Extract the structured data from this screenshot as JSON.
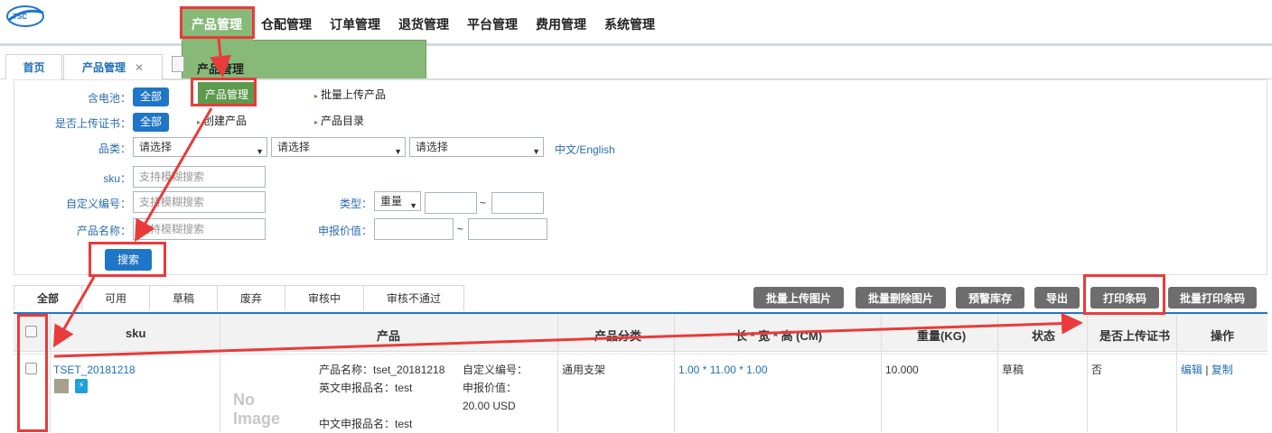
{
  "top_nav": {
    "items": [
      "产品管理",
      "仓配管理",
      "订单管理",
      "退货管理",
      "平台管理",
      "费用管理",
      "系统管理"
    ]
  },
  "menu": {
    "header": "产品管理",
    "items": [
      "产品管理",
      "批量上传产品",
      "创建产品",
      "产品目录"
    ]
  },
  "page_tabs": {
    "home": "首页",
    "product": "产品管理",
    "close": "✕"
  },
  "filter": {
    "battery_label": "含电池：",
    "battery_value": "全部",
    "cert_label": "是否上传证书：",
    "cert_value": "全部",
    "category_label": "品类：",
    "category_options": [
      "请选择",
      "请选择",
      "请选择"
    ],
    "lang_link": "中文/English",
    "sku_label": "sku：",
    "sku_placeholder": "支持模糊搜索",
    "custom_label": "自定义编号：",
    "custom_placeholder": "支持模糊搜索",
    "name_label": "产品名称：",
    "name_placeholder": "支持模糊搜索",
    "type_label": "类型：",
    "type_value": "重量",
    "tilde": "~",
    "declared_label": "申报价值：",
    "search_button": "搜索"
  },
  "status_tabs": [
    "全部",
    "可用",
    "草稿",
    "废弃",
    "审核中",
    "审核不通过"
  ],
  "actions": [
    "批量上传图片",
    "批量删除图片",
    "预警库存",
    "导出",
    "打印条码",
    "批量打印条码"
  ],
  "table": {
    "headers": [
      "sku",
      "产品",
      "产品分类",
      "长 * 宽 * 高 (CM)",
      "重量(KG)",
      "状态",
      "是否上传证书",
      "操作"
    ],
    "row": {
      "sku": "TSET_20181218",
      "no_image": "No Image",
      "name": "产品名称：tset_20181218",
      "en_name": "英文申报品名：test",
      "cn_name": "中文申报品名：test",
      "custom_no": "自定义编号：",
      "declared": "申报价值：",
      "declared_val": "20.00 USD",
      "category": "通用支架",
      "dims": "1.00 * 11.00 * 1.00",
      "weight": "10.000",
      "status": "草稿",
      "cert": "否",
      "edit": "编辑",
      "sep": "|",
      "copy": "复制"
    }
  },
  "colors": {
    "menu_green": "#87b979",
    "primary_blue": "#1f76c8",
    "annotation_red": "#e93b3b"
  }
}
